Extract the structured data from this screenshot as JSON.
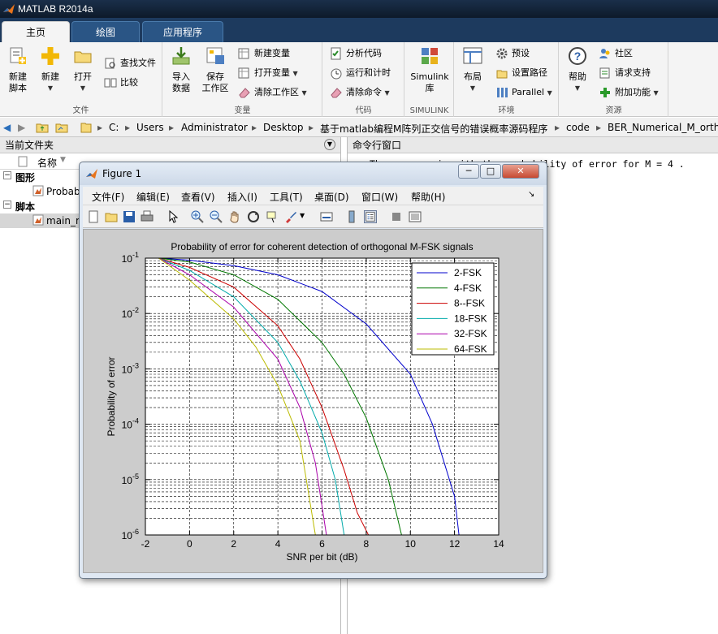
{
  "app": {
    "title": "MATLAB R2014a"
  },
  "tabs": [
    {
      "label": "主页"
    },
    {
      "label": "绘图"
    },
    {
      "label": "应用程序"
    }
  ],
  "ribbon": {
    "file": {
      "label": "文件",
      "new_script": "新建\n脚本",
      "new": "新建",
      "open": "打开",
      "find_files": "查找文件",
      "compare": "比较"
    },
    "variable": {
      "label": "变量",
      "import": "导入\n数据",
      "save_ws": "保存\n工作区",
      "new_var": "新建变量",
      "open_var": "打开变量",
      "clear_ws": "清除工作区"
    },
    "code": {
      "label": "代码",
      "analyze": "分析代码",
      "run_time": "运行和计时",
      "clear_cmd": "清除命令"
    },
    "simulink": {
      "label": "SIMULINK",
      "lib": "Simulink\n库"
    },
    "env": {
      "label": "环境",
      "layout": "布局",
      "prefs": "预设",
      "set_path": "设置路径",
      "parallel": "Parallel"
    },
    "resources": {
      "label": "资源",
      "help": "帮助",
      "community": "社区",
      "support": "请求支持",
      "addons": "附加功能"
    }
  },
  "address": {
    "crumbs": [
      "C:",
      "Users",
      "Administrator",
      "Desktop",
      "基于matlab编程M阵列正交信号的错误概率源码程序",
      "code",
      "BER_Numerical_M_ortho"
    ]
  },
  "current_folder": {
    "title": "当前文件夹",
    "col_name": "名称",
    "groups": [
      {
        "label": "图形",
        "item": "Probab"
      },
      {
        "label": "脚本",
        "item": "main_m"
      }
    ]
  },
  "command_window": {
    "title": "命令行窗口",
    "text": "The program is  with  the  probability of error for M = 4 ."
  },
  "figure": {
    "title": "Figure 1",
    "menu": [
      "文件(F)",
      "编辑(E)",
      "查看(V)",
      "插入(I)",
      "工具(T)",
      "桌面(D)",
      "窗口(W)",
      "帮助(H)"
    ]
  },
  "chart_data": {
    "type": "line",
    "title": "Probability of error for coherent detection of orthogonal M-FSK signals",
    "xlabel": "SNR per bit (dB)",
    "ylabel": "Probability of error",
    "xlim": [
      -2,
      14
    ],
    "ylim": [
      1e-06,
      0.1
    ],
    "yscale": "log",
    "xticks": [
      "-2",
      "0",
      "2",
      "4",
      "6",
      "8",
      "10",
      "12",
      "14"
    ],
    "yticks": [
      {
        "base": "10",
        "exp": "-1"
      },
      {
        "base": "10",
        "exp": "-2"
      },
      {
        "base": "10",
        "exp": "-3"
      },
      {
        "base": "10",
        "exp": "-4"
      },
      {
        "base": "10",
        "exp": "-5"
      },
      {
        "base": "10",
        "exp": "-6"
      }
    ],
    "grid": true,
    "legend_position": "top-right",
    "series": [
      {
        "name": "2-FSK",
        "color": "#0000cc",
        "x": [
          -1.4,
          0,
          2,
          4,
          6,
          8,
          10,
          11,
          12,
          12.2
        ],
        "y": [
          0.1,
          0.092,
          0.073,
          0.05,
          0.025,
          0.0065,
          0.0008,
          0.0001,
          5e-06,
          1e-06
        ]
      },
      {
        "name": "4-FSK",
        "color": "#007700",
        "x": [
          -1.4,
          0,
          2,
          4,
          6,
          7,
          8,
          9,
          9.6
        ],
        "y": [
          0.1,
          0.085,
          0.05,
          0.018,
          0.003,
          0.0008,
          0.00013,
          1e-05,
          1e-06
        ]
      },
      {
        "name": "8--FSK",
        "color": "#cc0000",
        "x": [
          -1.4,
          0,
          2,
          4,
          5,
          6,
          7,
          7.6,
          8.1
        ],
        "y": [
          0.1,
          0.068,
          0.03,
          0.006,
          0.0015,
          0.0002,
          1.5e-05,
          2.5e-06,
          1e-06
        ]
      },
      {
        "name": "18-FSK",
        "color": "#00aaaa",
        "x": [
          -1.4,
          0,
          2,
          4,
          5,
          6,
          6.6,
          7
        ],
        "y": [
          0.1,
          0.06,
          0.02,
          0.003,
          0.0006,
          7e-05,
          1e-05,
          1e-06
        ]
      },
      {
        "name": "32-FSK",
        "color": "#aa00aa",
        "x": [
          -1.4,
          0,
          2,
          4,
          5,
          5.7,
          6.2
        ],
        "y": [
          0.1,
          0.05,
          0.013,
          0.0015,
          0.0002,
          2e-05,
          1e-06
        ]
      },
      {
        "name": "64-FSK",
        "color": "#bbbb00",
        "x": [
          -1.4,
          0,
          2,
          3,
          4,
          5,
          5.7
        ],
        "y": [
          0.1,
          0.04,
          0.008,
          0.0025,
          0.0005,
          5e-05,
          1e-06
        ]
      }
    ]
  }
}
